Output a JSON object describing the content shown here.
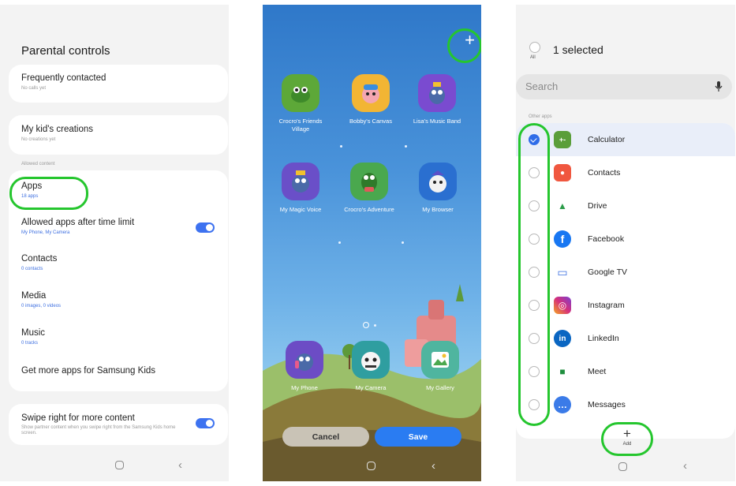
{
  "left": {
    "title": "Parental controls",
    "frequent": {
      "label": "Frequently contacted",
      "sub": "No calls yet"
    },
    "creations": {
      "label": "My kid's creations",
      "sub": "No creations yet"
    },
    "section_label": "Allowed content",
    "apps": {
      "label": "Apps",
      "sub": "18 apps"
    },
    "allowed_after": {
      "label": "Allowed apps after time limit",
      "sub": "My Phone, My Camera",
      "toggle_on": true
    },
    "contacts": {
      "label": "Contacts",
      "sub": "0 contacts"
    },
    "media": {
      "label": "Media",
      "sub": "0 images, 0 videos"
    },
    "music": {
      "label": "Music",
      "sub": "0 tracks"
    },
    "get_more": {
      "label": "Get more apps for Samsung Kids"
    },
    "swipe": {
      "label": "Swipe right for more content",
      "sub": "Show partner content when you swipe right from the Samsung Kids home screen.",
      "toggle_on": true
    }
  },
  "middle": {
    "add_label": "+",
    "apps": [
      {
        "name": "Crocro's Friends Village",
        "color": "#5da838"
      },
      {
        "name": "Bobby's Canvas",
        "color": "#f2b534"
      },
      {
        "name": "Lisa's Music Band",
        "color": "#7a4bd0"
      },
      {
        "name": "My Magic Voice",
        "color": "#6a4fc8"
      },
      {
        "name": "Crocro's Adventure",
        "color": "#4aa84e"
      },
      {
        "name": "My Browser",
        "color": "#2a6fd0"
      }
    ],
    "dock": [
      {
        "name": "My Phone",
        "color": "#6c4cc5"
      },
      {
        "name": "My Camera",
        "color": "#2f9ea0"
      },
      {
        "name": "My Gallery",
        "color": "#4fb59f"
      }
    ],
    "cancel_label": "Cancel",
    "save_label": "Save"
  },
  "right": {
    "all_label": "All",
    "selected_text": "1 selected",
    "search_placeholder": "Search",
    "section_label": "Other apps",
    "apps": [
      {
        "name": "Calculator",
        "selected": true,
        "color": "#5a9e3a",
        "glyph": "+-"
      },
      {
        "name": "Contacts",
        "selected": false,
        "color": "#f0573f",
        "glyph": "●"
      },
      {
        "name": "Drive",
        "selected": false,
        "color": "#ffffff",
        "glyph": "▲"
      },
      {
        "name": "Facebook",
        "selected": false,
        "color": "#1877f2",
        "glyph": "f"
      },
      {
        "name": "Google TV",
        "selected": false,
        "color": "#ffffff",
        "glyph": "▭"
      },
      {
        "name": "Instagram",
        "selected": false,
        "color": "#d6307a",
        "glyph": "◎"
      },
      {
        "name": "LinkedIn",
        "selected": false,
        "color": "#0a66c2",
        "glyph": "in"
      },
      {
        "name": "Meet",
        "selected": false,
        "color": "#ffffff",
        "glyph": "■"
      },
      {
        "name": "Messages",
        "selected": false,
        "color": "#3b7be8",
        "glyph": "…"
      }
    ],
    "add_label": "Add",
    "add_glyph": "+"
  },
  "colors": {
    "highlight": "#25c62e",
    "accent": "#3d72f0",
    "save": "#2a7cf2"
  }
}
